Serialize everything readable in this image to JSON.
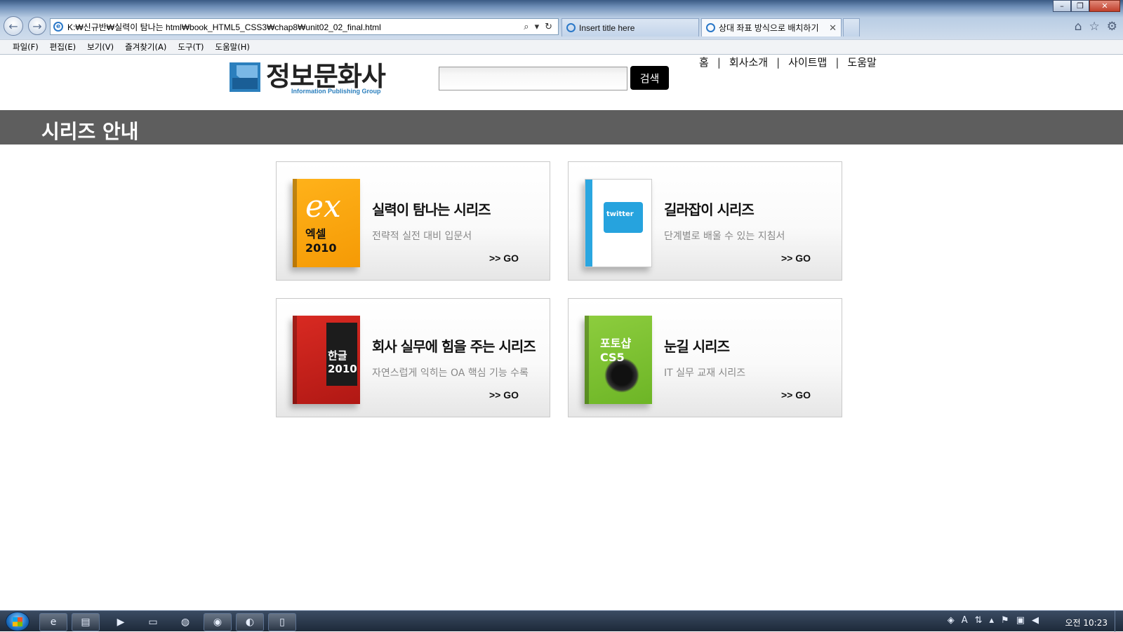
{
  "browser": {
    "address_url": "K:₩신규반₩실력이 탐나는 html₩book_HTML5_CSS3₩chap8₩unit02_02_final.html",
    "tabs": [
      {
        "label": "Insert title here",
        "active": false
      },
      {
        "label": "상대 좌표 방식으로 배치하기",
        "active": true
      }
    ],
    "menu": [
      "파일(F)",
      "편집(E)",
      "보기(V)",
      "즐겨찾기(A)",
      "도구(T)",
      "도움말(H)"
    ]
  },
  "header": {
    "logo_name": "정보문화사",
    "logo_sub": "Information Publishing Group",
    "search_placeholder": "",
    "search_button": "검색",
    "links": [
      "홈",
      "회사소개",
      "사이트맵",
      "도움말"
    ],
    "link_separator": "|"
  },
  "section": {
    "title": "시리즈 안내"
  },
  "cards": [
    {
      "title": "실력이 탐나는 시리즈",
      "desc": "전략적 실전 대비 입문서",
      "go": ">> GO",
      "book_label": "엑셀 2010",
      "book_deco": "ex"
    },
    {
      "title": "길라잡이 시리즈",
      "desc": "단계별로 배울 수 있는 지침서",
      "go": ">> GO",
      "book_label": "twitter",
      "book_deco": ""
    },
    {
      "title": "회사 실무에 힘을 주는 시리즈",
      "desc": "자연스럽게 익히는 OA 핵심 기능 수록",
      "go": ">> GO",
      "book_label": "한글 2010",
      "book_deco": ""
    },
    {
      "title": "눈길 시리즈",
      "desc": "IT 실무 교재 시리즈",
      "go": ">> GO",
      "book_label": "포토샵 CS5",
      "book_deco": ""
    }
  ],
  "taskbar": {
    "clock": "오전 10:23"
  },
  "colors": {
    "section_bar": "#5e5e5e",
    "search_button": "#000000",
    "logo_blue": "#2b7fbd"
  }
}
